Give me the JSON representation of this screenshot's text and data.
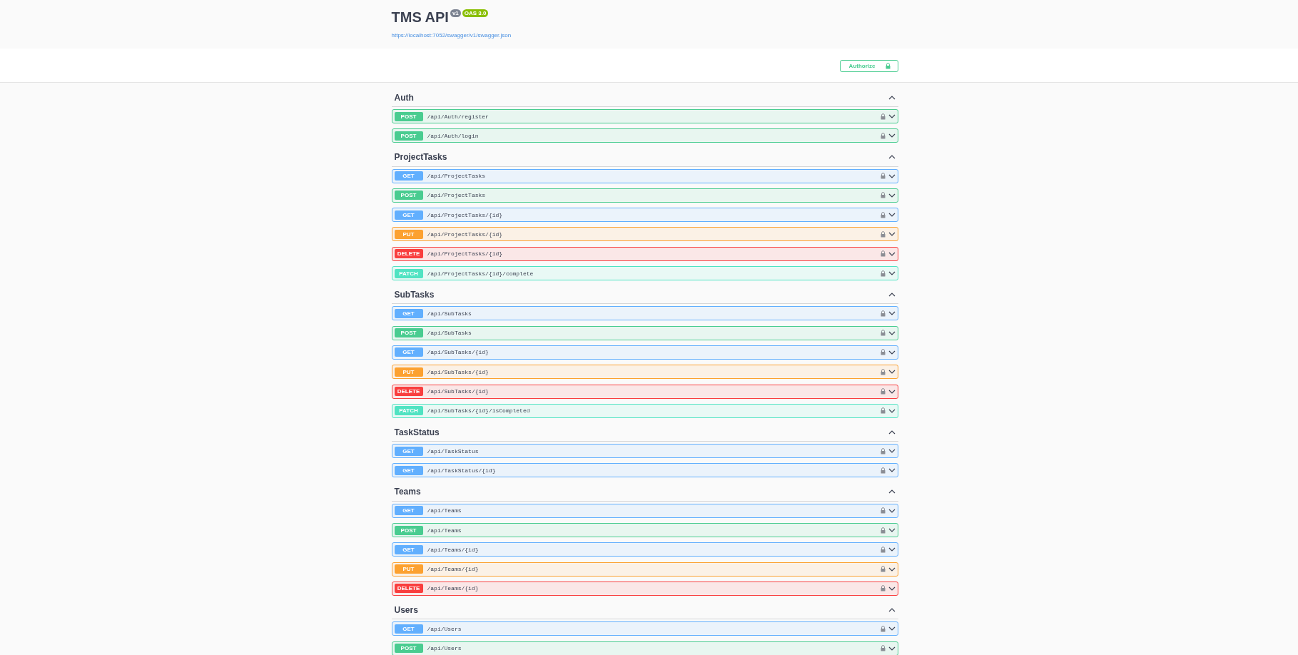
{
  "info": {
    "title": "TMS API",
    "version": "v1",
    "oas": "OAS 3.0",
    "url": "https://localhost:7052/swagger/v1/swagger.json"
  },
  "authorize": {
    "label": "Authorize"
  },
  "sections": [
    {
      "name": "Auth",
      "expanded": true,
      "operations": [
        {
          "kind": "post",
          "method": "POST",
          "path": "/api/Auth/register"
        },
        {
          "kind": "post",
          "method": "POST",
          "path": "/api/Auth/login"
        }
      ]
    },
    {
      "name": "ProjectTasks",
      "expanded": true,
      "operations": [
        {
          "kind": "get",
          "method": "GET",
          "path": "/api/ProjectTasks"
        },
        {
          "kind": "post",
          "method": "POST",
          "path": "/api/ProjectTasks"
        },
        {
          "kind": "get",
          "method": "GET",
          "path": "/api/ProjectTasks/{id}"
        },
        {
          "kind": "put",
          "method": "PUT",
          "path": "/api/ProjectTasks/{id}"
        },
        {
          "kind": "delete",
          "method": "DELETE",
          "path": "/api/ProjectTasks/{id}"
        },
        {
          "kind": "patch",
          "method": "PATCH",
          "path": "/api/ProjectTasks/{id}/complete"
        }
      ]
    },
    {
      "name": "SubTasks",
      "expanded": true,
      "operations": [
        {
          "kind": "get",
          "method": "GET",
          "path": "/api/SubTasks"
        },
        {
          "kind": "post",
          "method": "POST",
          "path": "/api/SubTasks"
        },
        {
          "kind": "get",
          "method": "GET",
          "path": "/api/SubTasks/{id}"
        },
        {
          "kind": "put",
          "method": "PUT",
          "path": "/api/SubTasks/{id}"
        },
        {
          "kind": "delete",
          "method": "DELETE",
          "path": "/api/SubTasks/{id}"
        },
        {
          "kind": "patch",
          "method": "PATCH",
          "path": "/api/SubTasks/{id}/isCompleted"
        }
      ]
    },
    {
      "name": "TaskStatus",
      "expanded": true,
      "operations": [
        {
          "kind": "get",
          "method": "GET",
          "path": "/api/TaskStatus"
        },
        {
          "kind": "get",
          "method": "GET",
          "path": "/api/TaskStatus/{id}"
        }
      ]
    },
    {
      "name": "Teams",
      "expanded": true,
      "operations": [
        {
          "kind": "get",
          "method": "GET",
          "path": "/api/Teams"
        },
        {
          "kind": "post",
          "method": "POST",
          "path": "/api/Teams"
        },
        {
          "kind": "get",
          "method": "GET",
          "path": "/api/Teams/{id}"
        },
        {
          "kind": "put",
          "method": "PUT",
          "path": "/api/Teams/{id}"
        },
        {
          "kind": "delete",
          "method": "DELETE",
          "path": "/api/Teams/{id}"
        }
      ]
    },
    {
      "name": "Users",
      "expanded": true,
      "operations": [
        {
          "kind": "get",
          "method": "GET",
          "path": "/api/Users"
        },
        {
          "kind": "post",
          "method": "POST",
          "path": "/api/Users"
        }
      ]
    }
  ]
}
